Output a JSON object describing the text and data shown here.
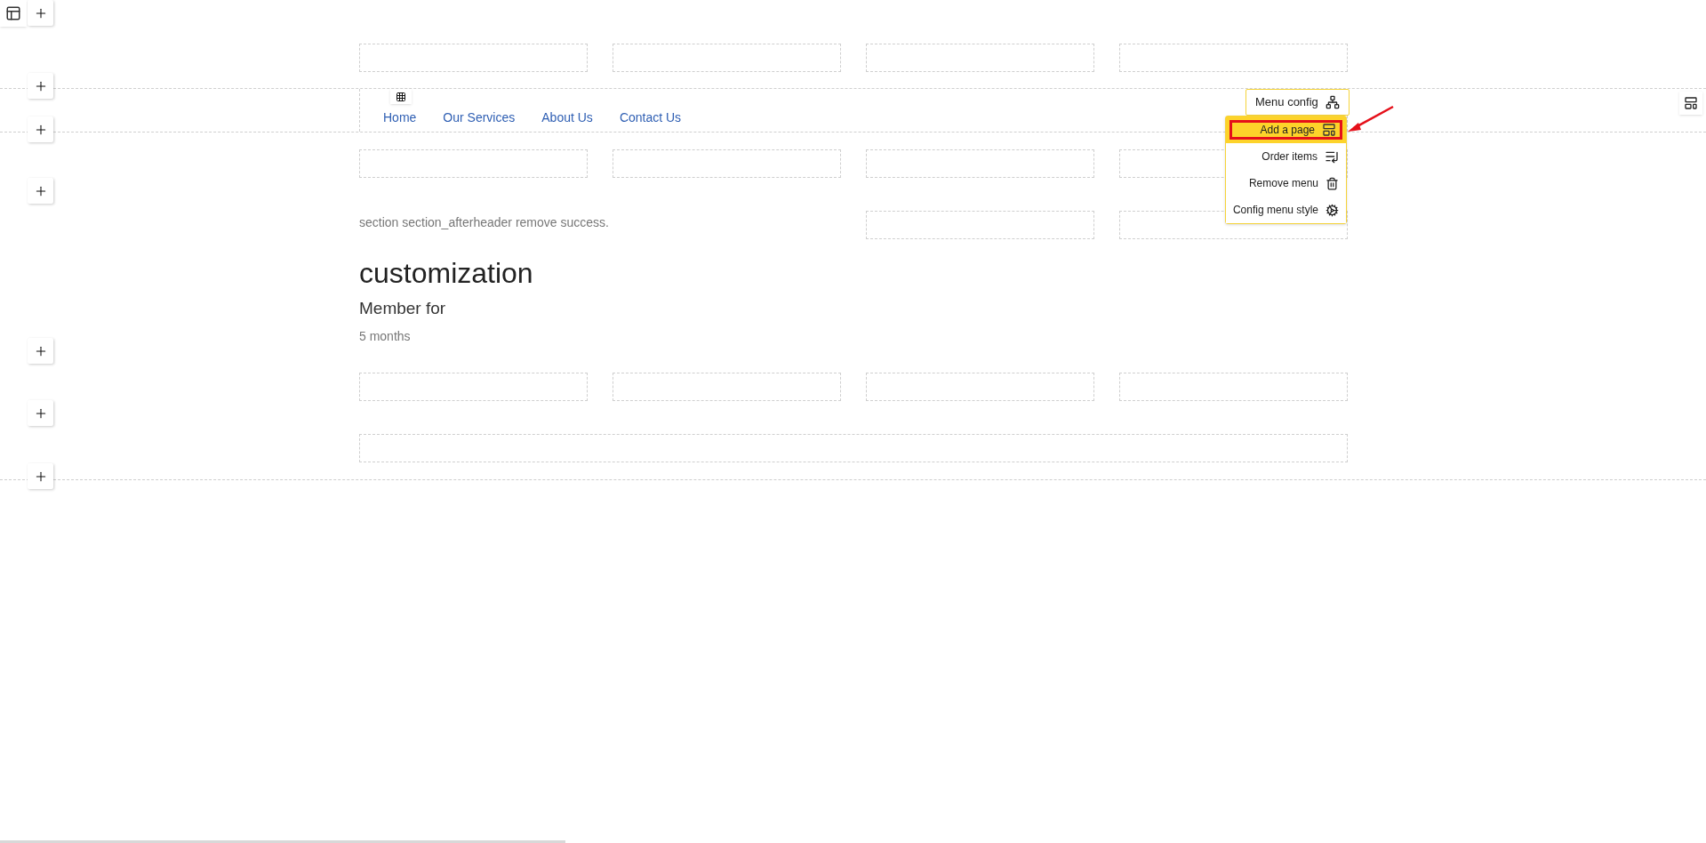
{
  "nav": {
    "items": [
      {
        "label": "Home"
      },
      {
        "label": "Our Services"
      },
      {
        "label": "About Us"
      },
      {
        "label": "Contact Us"
      }
    ]
  },
  "message": "section section_afterheader remove success.",
  "heading": "customization",
  "subheading": "Member for",
  "meta": "5 months",
  "menu_config": {
    "button": "Menu config",
    "items": [
      {
        "label": "Add a page",
        "kind": "add-page",
        "selected": true
      },
      {
        "label": "Order items",
        "kind": "order",
        "selected": false
      },
      {
        "label": "Remove menu",
        "kind": "remove",
        "selected": false
      },
      {
        "label": "Config menu style",
        "kind": "style",
        "selected": false
      }
    ]
  }
}
